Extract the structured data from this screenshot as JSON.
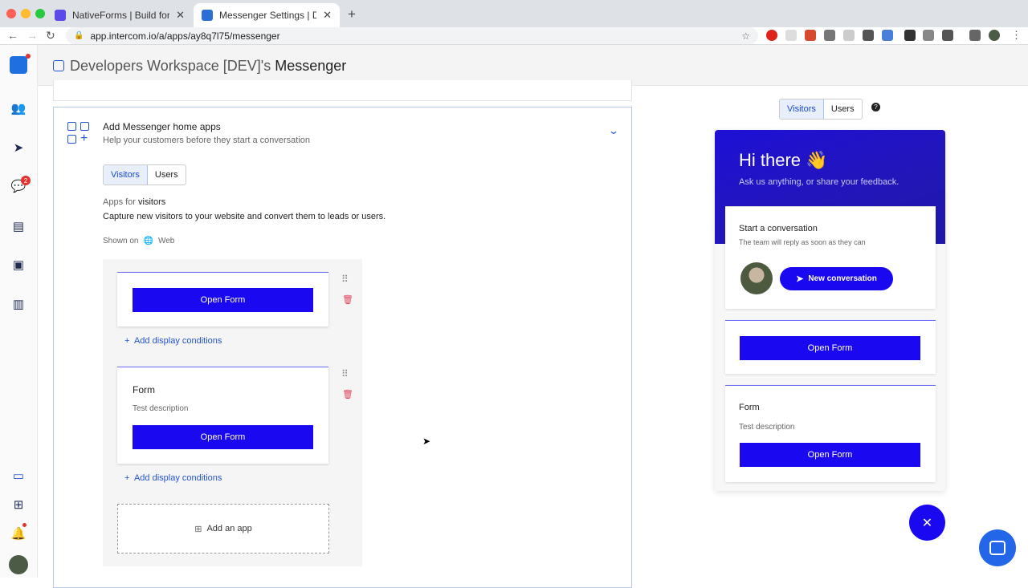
{
  "browser": {
    "tabs": [
      {
        "title": "NativeForms | Build forms, sur",
        "favicon_color": "#5b4ae8"
      },
      {
        "title": "Messenger Settings | Develope",
        "favicon_color": "#2b6fd6"
      }
    ],
    "url": "app.intercom.io/a/apps/ay8q7l75/messenger",
    "new_tab": "+"
  },
  "sidebar": {
    "notification_badge": "2"
  },
  "header": {
    "workspace": "Developers Workspace [DEV]'s",
    "page": "Messenger"
  },
  "section": {
    "title": "Add Messenger home apps",
    "subtitle": "Help your customers before they start a conversation",
    "audience_tabs": [
      "Visitors",
      "Users"
    ],
    "apps_for_prefix": "Apps for",
    "apps_for_value": "visitors",
    "description": "Capture new visitors to your website and convert them to leads or users.",
    "shown_on_label": "Shown on",
    "shown_on_value": "Web",
    "app_cards": [
      {
        "button": "Open Form",
        "condition_link": "Add display conditions"
      },
      {
        "title": "Form",
        "description": "Test description",
        "button": "Open Form",
        "condition_link": "Add display conditions"
      }
    ],
    "add_app_label": "Add an app"
  },
  "preview": {
    "audience_tabs": [
      "Visitors",
      "Users"
    ],
    "help": "?",
    "greeting": "Hi there 👋",
    "tagline": "Ask us anything, or share your feedback.",
    "conversation": {
      "title": "Start a conversation",
      "subtitle": "The team will reply as soon as they can",
      "button": "New conversation"
    },
    "cards": [
      {
        "button": "Open Form"
      },
      {
        "title": "Form",
        "description": "Test description",
        "button": "Open Form"
      }
    ],
    "close": "✕"
  },
  "colors": {
    "accent": "#1a09f0",
    "brand_dark": "#1f17a8"
  }
}
